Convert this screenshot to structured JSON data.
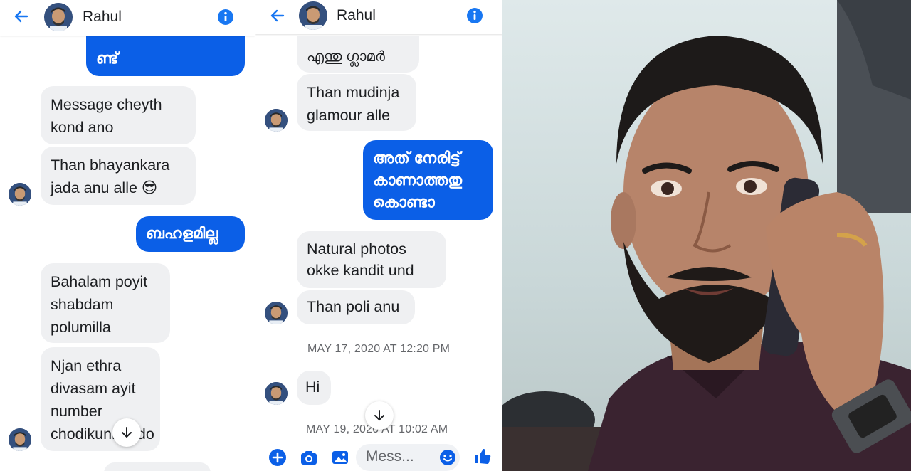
{
  "left_chat": {
    "header": {
      "name": "Rahul"
    },
    "messages": {
      "sent_top": "ണ്ട്",
      "recv_1": [
        "Message cheyth",
        "kond ano"
      ],
      "recv_2_text": [
        "Than bhayankara",
        "jada anu alle"
      ],
      "recv_2_emoji": "😎",
      "sent_2": "ബഹളമില്ല",
      "recv_3": [
        "Bahalam poyit",
        "shabdam",
        "polumilla"
      ],
      "recv_4": [
        "Njan ethra",
        "divasam ayit",
        "number",
        "chodikunnundo"
      ]
    }
  },
  "mid_chat": {
    "header": {
      "name": "Rahul"
    },
    "messages": {
      "recv_top": "എന്തു ഗ്ലാമർ",
      "recv_1": [
        "Than mudinja",
        "glamour alle"
      ],
      "sent_1": [
        "അത് നേരിട്ട്",
        "കാണാത്തതു",
        "കൊണ്ടാ"
      ],
      "recv_2": [
        "Natural photos",
        "okke kandit und"
      ],
      "recv_3": "Than poli anu",
      "timestamp_1": "MAY 17, 2020 AT 12:20 PM",
      "recv_4": "Hi",
      "timestamp_2": "MAY 19, 2020 AT 10:02 AM"
    },
    "composer": {
      "placeholder": "Mess..."
    }
  },
  "colors": {
    "accent": "#0b5fe7",
    "bubble_received": "#eff0f2",
    "messenger_blue": "#1877f2"
  },
  "icons": [
    "back-arrow-icon",
    "info-icon",
    "scroll-down-icon",
    "add-icon",
    "camera-icon",
    "image-icon",
    "emoji-icon",
    "like-icon"
  ]
}
